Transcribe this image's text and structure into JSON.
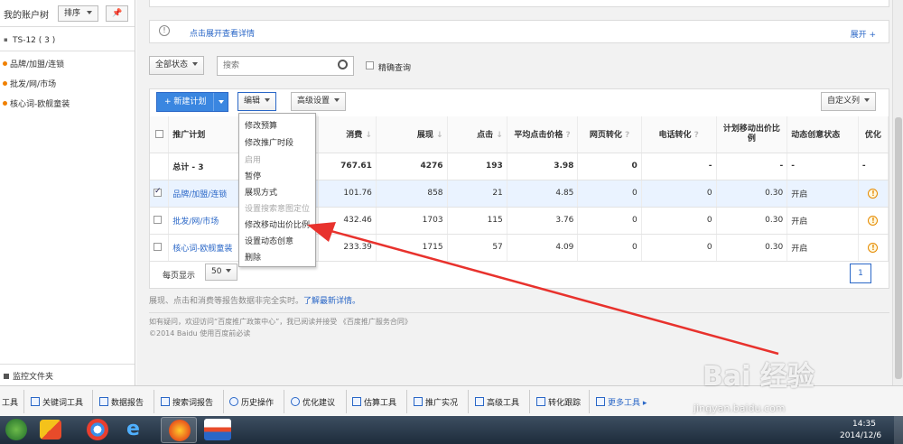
{
  "sidebar": {
    "title": "我的账户树",
    "sort_label": "排序",
    "account": "TS-12 ( 3 )",
    "items": [
      {
        "label": "品牌/加盟/连锁"
      },
      {
        "label": "批发/网/市场"
      },
      {
        "label": "核心词-欧舰童装"
      }
    ],
    "bottom": "监控文件夹"
  },
  "notice": {
    "text": "点击展开查看详情",
    "expand": "展开 +"
  },
  "filter": {
    "status": "全部状态",
    "search_placeholder": "搜索",
    "exact": "精确查询"
  },
  "actions": {
    "new_plan": "+ 新建计划",
    "edit": "编辑",
    "advanced": "高级设置",
    "custom_cols": "自定义列"
  },
  "dropdown": [
    {
      "label": "修改预算",
      "disabled": false
    },
    {
      "label": "修改推广时段",
      "disabled": false
    },
    {
      "label": "启用",
      "disabled": true
    },
    {
      "label": "暂停",
      "disabled": false
    },
    {
      "label": "展现方式",
      "disabled": false
    },
    {
      "label": "设置搜索意图定位",
      "disabled": true
    },
    {
      "label": "修改移动出价比例",
      "disabled": false
    },
    {
      "label": "设置动态创意",
      "disabled": false
    },
    {
      "label": "删除",
      "disabled": false
    }
  ],
  "table": {
    "headers": {
      "plan": "推广计划",
      "cost": "消费",
      "impressions": "展现",
      "clicks": "点击",
      "cpc": "平均点击价格",
      "web_conv": "网页转化",
      "phone_conv": "电话转化",
      "mobile_ratio": "计划移动出价比例",
      "dynamic": "动态创意状态",
      "opt": "优化"
    },
    "total": {
      "label": "总计 - 3",
      "cost": "767.61",
      "impressions": "4276",
      "clicks": "193",
      "cpc": "3.98",
      "web_conv": "0",
      "phone_conv": "-",
      "mobile_ratio": "-",
      "dynamic": "-",
      "opt": "-"
    },
    "rows": [
      {
        "plan": "品牌/加盟/连锁",
        "cost": "101.76",
        "impressions": "858",
        "clicks": "21",
        "cpc": "4.85",
        "web_conv": "0",
        "phone_conv": "0",
        "mobile_ratio": "0.30",
        "dynamic": "开启"
      },
      {
        "plan": "批发/网/市场",
        "cost": "432.46",
        "impressions": "1703",
        "clicks": "115",
        "cpc": "3.76",
        "web_conv": "0",
        "phone_conv": "0",
        "mobile_ratio": "0.30",
        "dynamic": "开启"
      },
      {
        "plan": "核心词-欧舰童装",
        "cost": "233.39",
        "impressions": "1715",
        "clicks": "57",
        "cpc": "4.09",
        "web_conv": "0",
        "phone_conv": "0",
        "mobile_ratio": "0.30",
        "dynamic": "开启"
      }
    ]
  },
  "pager": {
    "per_page_label": "每页显示",
    "per_page": "50",
    "page": "1"
  },
  "footnote": {
    "text": "展现、点击和消费等报告数据非完全实时。",
    "link": "了解最新详情。"
  },
  "footer": {
    "line1": "如有疑问，欢迎访问“百度推广政策中心”，我已阅读并接受 《百度推广服务合同》",
    "line2": "©2014  Baidu  使用百度前必读"
  },
  "toolbar": [
    {
      "label": "工具"
    },
    {
      "label": "关键词工具"
    },
    {
      "label": "数据报告"
    },
    {
      "label": "搜索词报告"
    },
    {
      "label": "历史操作"
    },
    {
      "label": "优化建议"
    },
    {
      "label": "估算工具"
    },
    {
      "label": "推广实况"
    },
    {
      "label": "高级工具"
    },
    {
      "label": "转化跟踪"
    },
    {
      "label": "更多工具 ▸"
    }
  ],
  "watermark": {
    "text": "Bai 经验",
    "url": "jingyan.baidu.com"
  },
  "clock": {
    "time": "14:35",
    "date": "2014/12/6"
  },
  "colors": {
    "accent": "#2a67c7",
    "arrow": "#e8322d",
    "new_btn": "#3a86e0"
  }
}
